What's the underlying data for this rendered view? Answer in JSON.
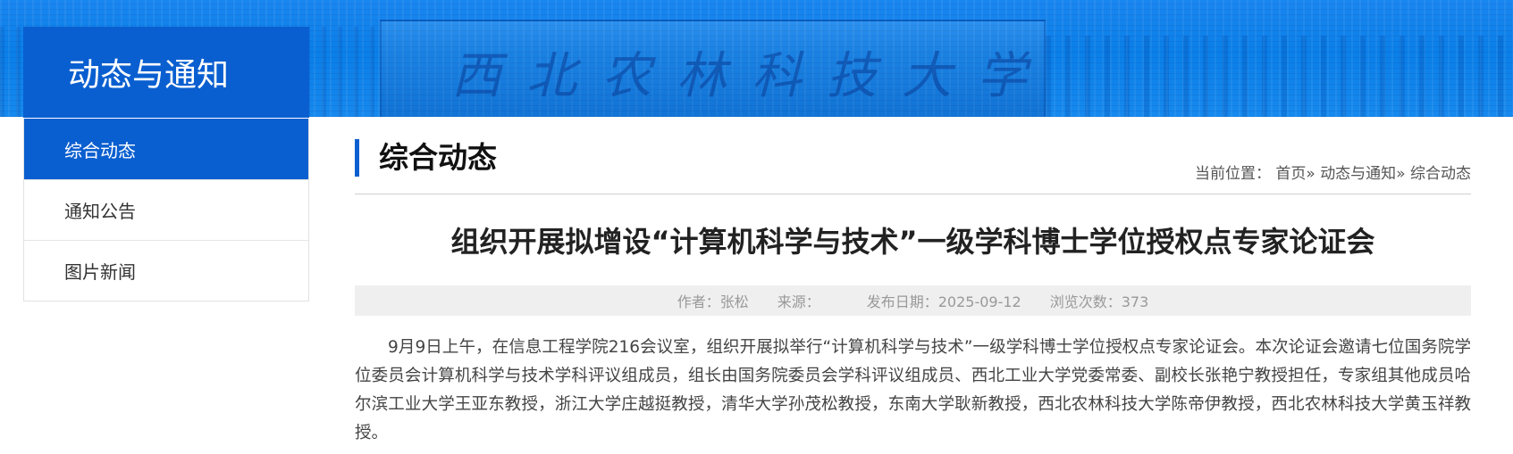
{
  "banner": {
    "motto_text": "西北农林科技大学"
  },
  "section": {
    "title": "动态与通知"
  },
  "sidenav": {
    "items": [
      {
        "label": "综合动态"
      },
      {
        "label": "通知公告"
      },
      {
        "label": "图片新闻"
      }
    ]
  },
  "content": {
    "heading": "综合动态",
    "breadcrumb": {
      "prefix": "当前位置：",
      "home": "首页",
      "sep1": "»",
      "level1": "动态与通知",
      "sep2": "»",
      "level2": "综合动态"
    }
  },
  "article": {
    "title": "组织开展拟增设“计算机科学与技术”一级学科博士学位授权点专家论证会",
    "meta": {
      "author_label": "作者：",
      "author": "张松",
      "source_label": "来源：",
      "source": "",
      "date_label": "发布日期：",
      "date": "2025-09-12",
      "views_label": "浏览次数：",
      "views": "373"
    },
    "body": "9月9日上午，在信息工程学院216会议室，组织开展拟举行“计算机科学与技术”一级学科博士学位授权点专家论证会。本次论证会邀请七位国务院学位委员会计算机科学与技术学科评议组成员，组长由国务院委员会学科评议组成员、西北工业大学党委常委、副校长张艳宁教授担任，专家组其他成员哈尔滨工业大学王亚东教授，浙江大学庄越挺教授，清华大学孙茂松教授，东南大学耿新教授，西北农林科技大学陈帝伊教授，西北农林科技大学黄玉祥教授。"
  },
  "colors": {
    "primary": "#0a5fd0",
    "banner": "#0a7fe8",
    "meta_bg": "#efefef"
  }
}
